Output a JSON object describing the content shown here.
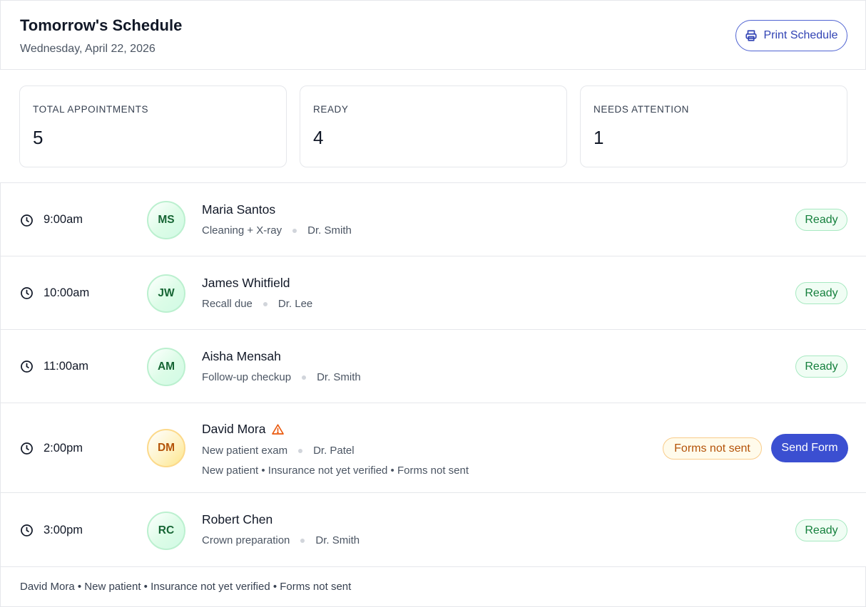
{
  "header": {
    "title": "Tomorrow's Schedule",
    "date": "Wednesday, April 22, 2026",
    "print_label": "Print Schedule",
    "print_icon": "printer-icon",
    "accent_color": "#3b4fd1"
  },
  "stats": [
    {
      "label": "TOTAL APPOINTMENTS",
      "value": "5"
    },
    {
      "label": "READY",
      "value": "4"
    },
    {
      "label": "NEEDS ATTENTION",
      "value": "1"
    }
  ],
  "appointments": [
    {
      "time": "9:00am",
      "initials": "MS",
      "name": "Maria Santos",
      "procedure": "Cleaning + X-ray",
      "doctor": "Dr. Smith",
      "status": "Ready"
    },
    {
      "time": "10:00am",
      "initials": "JW",
      "name": "James Whitfield",
      "procedure": "Recall due",
      "doctor": "Dr. Lee",
      "status": "Ready"
    },
    {
      "time": "11:00am",
      "initials": "AM",
      "name": "Aisha Mensah",
      "procedure": "Follow-up checkup",
      "doctor": "Dr. Smith",
      "status": "Ready"
    },
    {
      "time": "2:00pm",
      "initials": "DM",
      "name": "David Mora",
      "procedure": "New patient exam",
      "doctor": "Dr. Patel",
      "status": "Forms not sent",
      "details": "New patient • Insurance not yet verified • Forms not sent",
      "action_label": "Send Form",
      "warning_icon": "warning-icon"
    },
    {
      "time": "3:00pm",
      "initials": "RC",
      "name": "Robert Chen",
      "procedure": "Crown preparation",
      "doctor": "Dr. Smith",
      "status": "Ready"
    }
  ],
  "footer": {
    "note": "David Mora • New patient • Insurance not yet verified • Forms not sent"
  }
}
